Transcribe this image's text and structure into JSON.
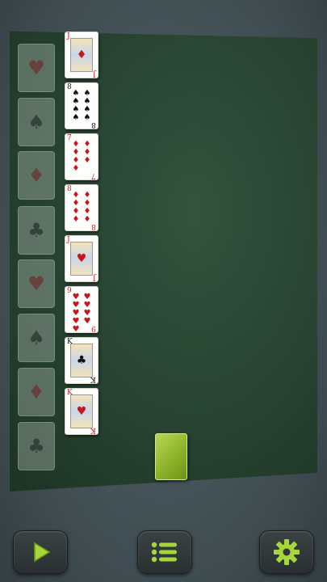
{
  "foundations": [
    {
      "suit": "heart",
      "glyph": "♥",
      "color": "red"
    },
    {
      "suit": "spade",
      "glyph": "♠",
      "color": "black"
    },
    {
      "suit": "diamond",
      "glyph": "♦",
      "color": "red"
    },
    {
      "suit": "club",
      "glyph": "♣",
      "color": "black"
    },
    {
      "suit": "heart",
      "glyph": "♥",
      "color": "red"
    },
    {
      "suit": "spade",
      "glyph": "♠",
      "color": "black"
    },
    {
      "suit": "diamond",
      "glyph": "♦",
      "color": "red"
    },
    {
      "suit": "club",
      "glyph": "♣",
      "color": "black"
    }
  ],
  "cards": [
    {
      "rank": "J",
      "glyph": "♦",
      "color": "red",
      "face": true
    },
    {
      "rank": "8",
      "glyph": "♠",
      "color": "black",
      "face": false
    },
    {
      "rank": "7",
      "glyph": "♦",
      "color": "red",
      "face": false
    },
    {
      "rank": "8",
      "glyph": "♦",
      "color": "red",
      "face": false
    },
    {
      "rank": "J",
      "glyph": "♥",
      "color": "red",
      "face": true
    },
    {
      "rank": "9",
      "glyph": "♥",
      "color": "red",
      "face": false
    },
    {
      "rank": "K",
      "glyph": "♣",
      "color": "black",
      "face": true
    },
    {
      "rank": "K",
      "glyph": "♥",
      "color": "red",
      "face": true
    }
  ],
  "colors": {
    "felt": "#274334",
    "stock_back": "#9bc23a",
    "button_icon": "#9fd23a"
  },
  "toolbar": {
    "play_icon": "play-icon",
    "menu_icon": "menu-icon",
    "settings_icon": "gear-icon"
  }
}
